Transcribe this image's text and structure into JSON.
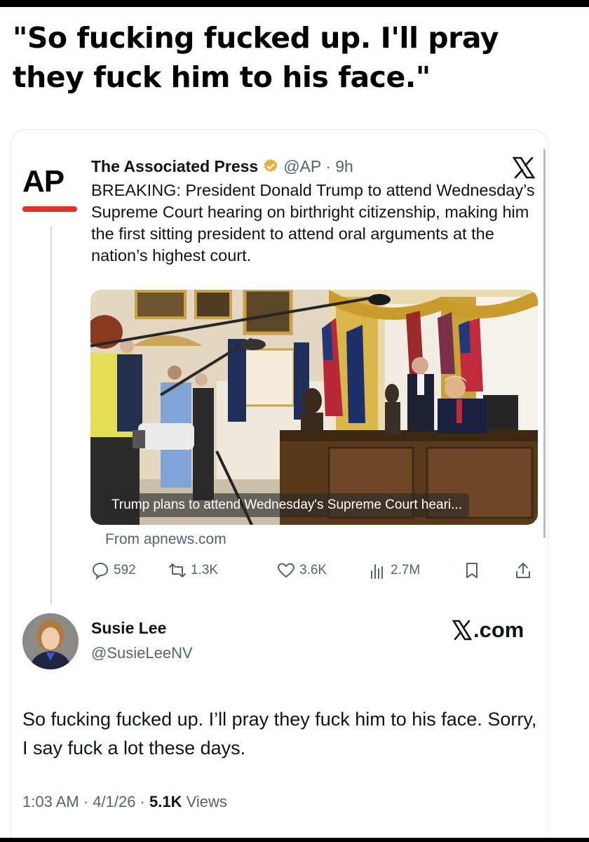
{
  "headline": "\"So fucking fucked up. I'll pray they fuck him to his face.\"",
  "quoted_tweet": {
    "logo_text": "AP",
    "author_name": "The Associated Press",
    "handle_time": "@AP · 9h",
    "text": "BREAKING: President Donald Trump to attend Wednesday’s Supreme Court hearing on birthright citizenship, making him the first sitting president to attend oral arguments at the nation’s highest court.",
    "media_caption": "Trump plans to attend Wednesday's Supreme Court heari...",
    "source": "From apnews.com",
    "actions": {
      "replies": "592",
      "reposts": "1.3K",
      "likes": "3.6K",
      "views": "2.7M"
    }
  },
  "reply": {
    "name": "Susie Lee",
    "handle": "@SusieLeeNV",
    "site_label": ".com",
    "text": "So fucking fucked up.  I’ll pray they fuck him to his face. Sorry, I say fuck a lot these days.",
    "time_date": "1:03 AM · 4/1/26 · ",
    "views_count": "5.1K",
    "views_label": " Views"
  },
  "colors": {
    "text": "#0f1419",
    "secondary": "#536471",
    "ap_red": "#e0302c",
    "verified_gold": "#e8b13a"
  }
}
